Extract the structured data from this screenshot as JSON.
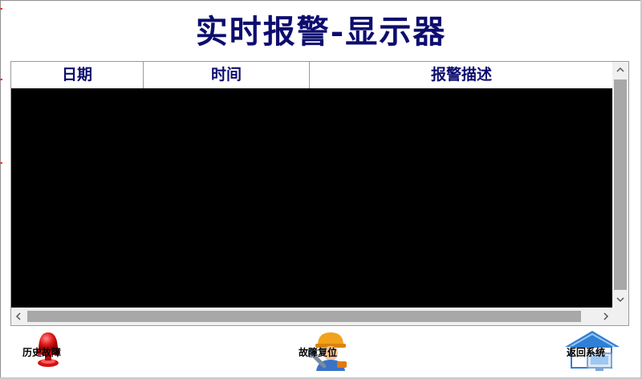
{
  "title": "实时报警-显示器",
  "table": {
    "columns": [
      "日期",
      "时间",
      "报警描述"
    ],
    "rows": []
  },
  "scrollbars": {
    "up_glyph": "^",
    "down_glyph": "v",
    "left_glyph": "<",
    "right_glyph": ">"
  },
  "actions": {
    "history": {
      "label": "历史故障",
      "icon": "alarm-light-icon"
    },
    "reset": {
      "label": "故障复位",
      "icon": "worker-wrench-icon"
    },
    "return": {
      "label": "返回系统",
      "icon": "house-computer-icon"
    }
  },
  "colors": {
    "title": "#0d0d6f",
    "grid_body": "#000000",
    "scroll_thumb": "#a8a8a8"
  }
}
